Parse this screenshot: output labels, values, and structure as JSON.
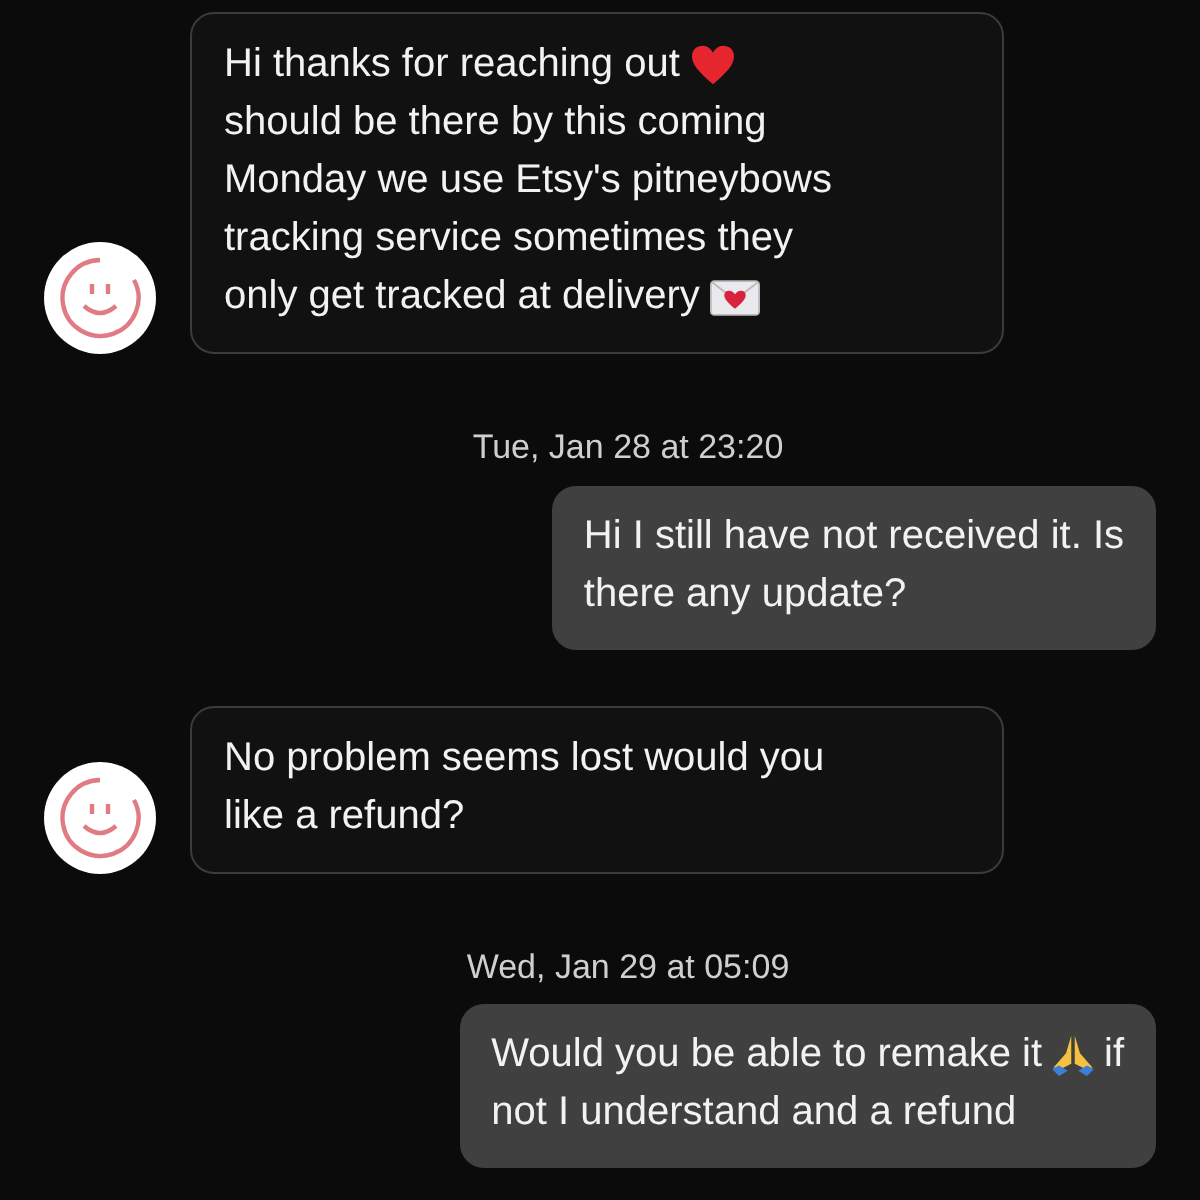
{
  "messages": [
    {
      "kind": "received",
      "lines": [
        [
          {
            "kind": "text",
            "text": "Hi thanks for reaching out"
          },
          {
            "kind": "heart"
          }
        ],
        [
          {
            "kind": "text",
            "text": "should be there by this coming"
          }
        ],
        [
          {
            "kind": "text",
            "text": "Monday we use Etsy's pitneybows"
          }
        ],
        [
          {
            "kind": "text",
            "text": "tracking service sometimes they"
          }
        ],
        [
          {
            "kind": "text",
            "text": "only get tracked at delivery"
          },
          {
            "kind": "envelope"
          }
        ]
      ]
    },
    {
      "kind": "timestamp",
      "text": "Tue, Jan 28 at 23:20"
    },
    {
      "kind": "sent",
      "lines": [
        [
          {
            "kind": "text",
            "text": "Hi I still have not received it. Is"
          }
        ],
        [
          {
            "kind": "text",
            "text": "there any update?"
          }
        ]
      ]
    },
    {
      "kind": "received",
      "lines": [
        [
          {
            "kind": "text",
            "text": "No problem seems lost would you"
          }
        ],
        [
          {
            "kind": "text",
            "text": "like a refund?"
          }
        ]
      ]
    },
    {
      "kind": "timestamp",
      "text": "Wed, Jan 29 at 05:09"
    },
    {
      "kind": "sent",
      "lines": [
        [
          {
            "kind": "text",
            "text": "Would you be able to remake it"
          },
          {
            "kind": "hands"
          },
          {
            "kind": "text",
            "text": "if"
          }
        ],
        [
          {
            "kind": "text",
            "text": "not I understand and a refund"
          }
        ]
      ]
    }
  ]
}
